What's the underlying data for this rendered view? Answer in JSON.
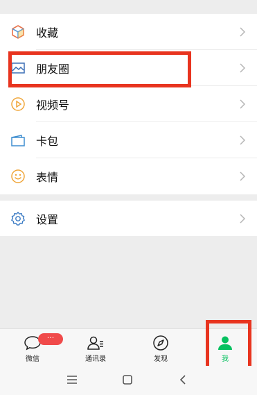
{
  "menu": {
    "items": [
      {
        "label": "收藏",
        "icon": "cube-icon"
      },
      {
        "label": "朋友圈",
        "icon": "image-icon"
      },
      {
        "label": "视频号",
        "icon": "play-circle-icon"
      },
      {
        "label": "卡包",
        "icon": "card-icon"
      },
      {
        "label": "表情",
        "icon": "smile-icon"
      }
    ],
    "settings": {
      "label": "设置",
      "icon": "gear-icon"
    }
  },
  "tabbar": {
    "chat": {
      "label": "微信",
      "badge": "···"
    },
    "contacts": {
      "label": "通讯录"
    },
    "discover": {
      "label": "发现"
    },
    "me": {
      "label": "我"
    }
  },
  "colors": {
    "accent": "#07c160",
    "highlight": "#e8341f",
    "badge": "#f04a4a"
  }
}
